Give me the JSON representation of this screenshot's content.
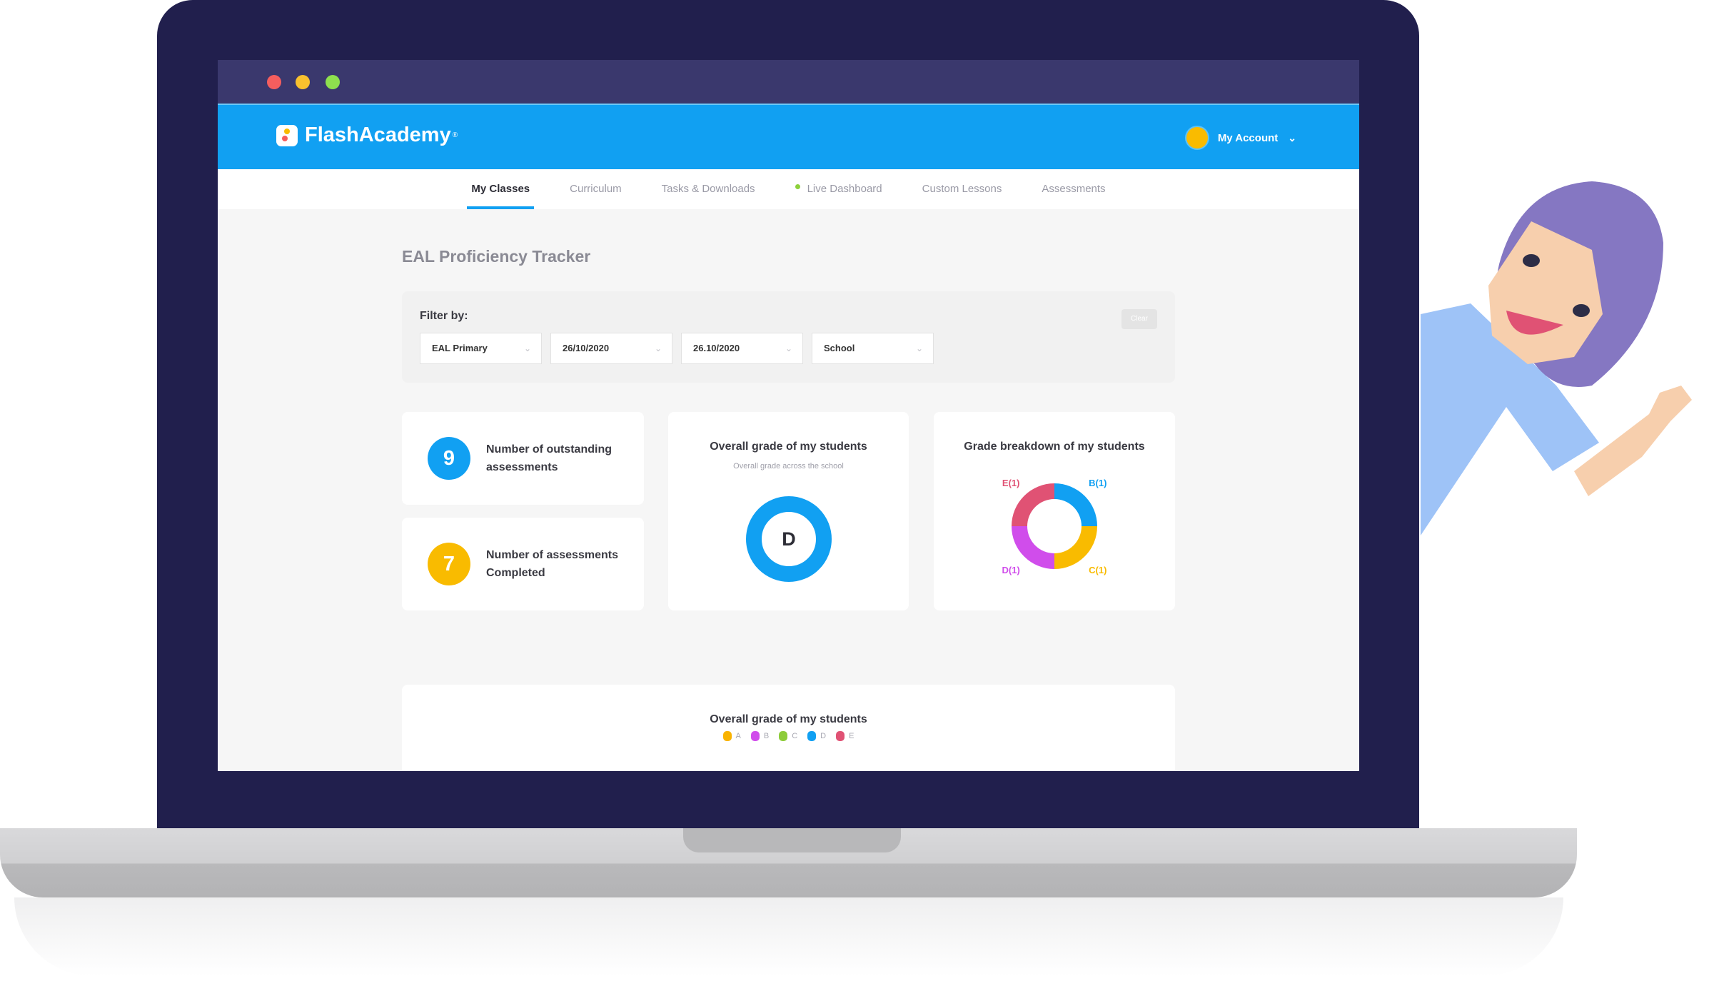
{
  "window": {
    "controls": [
      {
        "name": "close",
        "color": "#f55e5e"
      },
      {
        "name": "minimize",
        "color": "#f9c12e"
      },
      {
        "name": "maximize",
        "color": "#8ee04e"
      }
    ]
  },
  "header": {
    "brand": "FlashAcademy",
    "brand_mark": "®",
    "account_label": "My Account",
    "colors": {
      "header": "#11a0f2",
      "avatar": "#f9bb00"
    }
  },
  "nav": {
    "tabs": [
      {
        "label": "My Classes",
        "active": true
      },
      {
        "label": "Curriculum"
      },
      {
        "label": "Tasks & Downloads"
      },
      {
        "label": "Live Dashboard",
        "live_indicator": true
      },
      {
        "label": "Custom Lessons"
      },
      {
        "label": "Assessments"
      }
    ]
  },
  "page": {
    "title": "EAL Proficiency Tracker"
  },
  "filter": {
    "label": "Filter by:",
    "clear_label": "Clear",
    "selects": [
      {
        "value": "EAL Primary"
      },
      {
        "value": "26/10/2020"
      },
      {
        "value": "26.10/2020"
      },
      {
        "value": "School"
      }
    ]
  },
  "stats": [
    {
      "value": "9",
      "label": "Number of outstanding assessments",
      "color": "#11a0f2"
    },
    {
      "value": "7",
      "label": "Number of assessments Completed",
      "color": "#f9bb00"
    }
  ],
  "overall_card": {
    "title": "Overall grade of my students",
    "subtitle": "Overall grade across the school",
    "grade": "D",
    "color": "#11a0f2"
  },
  "chart_data": [
    {
      "type": "pie",
      "title": "Grade breakdown of my students",
      "donut": true,
      "categories": [
        "B",
        "C",
        "D",
        "E"
      ],
      "values": [
        1,
        1,
        1,
        1
      ],
      "labels": [
        "B(1)",
        "C(1)",
        "D(1)",
        "E(1)"
      ],
      "colors": [
        "#11a0f2",
        "#f9bb00",
        "#d04deb",
        "#e05274"
      ]
    },
    {
      "type": "bar",
      "title": "Overall grade of my students",
      "legend": "top",
      "series": [
        {
          "name": "A",
          "color": "#f9b300"
        },
        {
          "name": "B",
          "color": "#d04deb"
        },
        {
          "name": "C",
          "color": "#8dcc3a"
        },
        {
          "name": "D",
          "color": "#11a0f2"
        },
        {
          "name": "E",
          "color": "#e05274"
        }
      ]
    }
  ]
}
